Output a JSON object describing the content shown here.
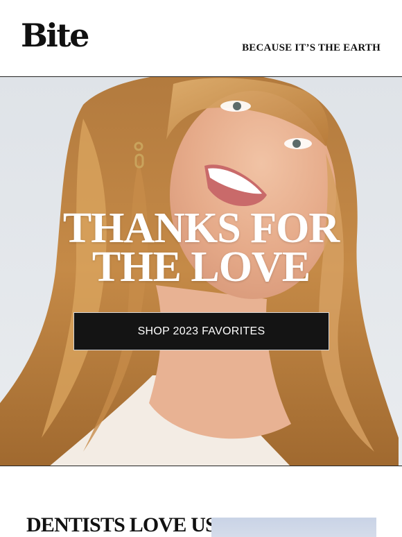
{
  "header": {
    "logo": "Bite",
    "tagline": "BECAUSE IT’S THE EARTH"
  },
  "hero": {
    "headline_line1": "THANKS FOR",
    "headline_line2": "THE LOVE",
    "cta_label": "SHOP 2023 FAVORITES"
  },
  "section": {
    "title": "DENTISTS LOVE US"
  },
  "colors": {
    "text": "#111111",
    "button_bg": "#141414",
    "hero_bg": "#e3e6ea"
  }
}
